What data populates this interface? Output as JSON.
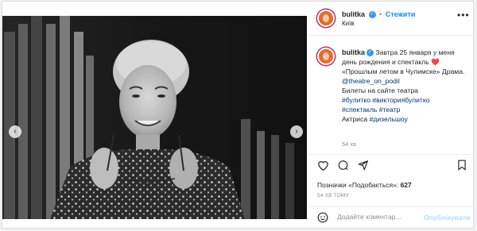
{
  "post": {
    "username": "bulitka",
    "follow_label": "Стежити",
    "location": "Київ",
    "more_icon": "more-horizontal-icon",
    "verified_icon": "verified-badge-icon"
  },
  "caption": {
    "username": "bulitka",
    "line1": "Завтра 25 января у меня",
    "line2": "день рождения и спектакль",
    "heart": "❤️",
    "line3": "«Прошлым летом в Чулимске» Драма.",
    "mention": "@theatre_on_podil",
    "line5": "Билеты на сайте театра",
    "hashtags1": "#булитко #викториябулитко",
    "hashtags2": "#спектакль #театр",
    "line8_prefix": "Актриса ",
    "hashtag_last": "#дизельшоу",
    "time": "54 хв"
  },
  "actions": {
    "icons": [
      "heart-icon",
      "comment-icon",
      "share-icon",
      "bookmark-icon"
    ]
  },
  "likes": {
    "label": "Позначки «Подобається»: ",
    "count": "627"
  },
  "time_ago": "54 ХВ ТОМУ",
  "comment": {
    "placeholder": "Додайте коментар...",
    "publish_label": "Опублікувати",
    "emoji_icon": "emoji-icon"
  },
  "photo": {
    "prev_icon": "chevron-left-icon",
    "next_icon": "chevron-right-icon",
    "prev_glyph": "‹",
    "next_glyph": "›"
  }
}
